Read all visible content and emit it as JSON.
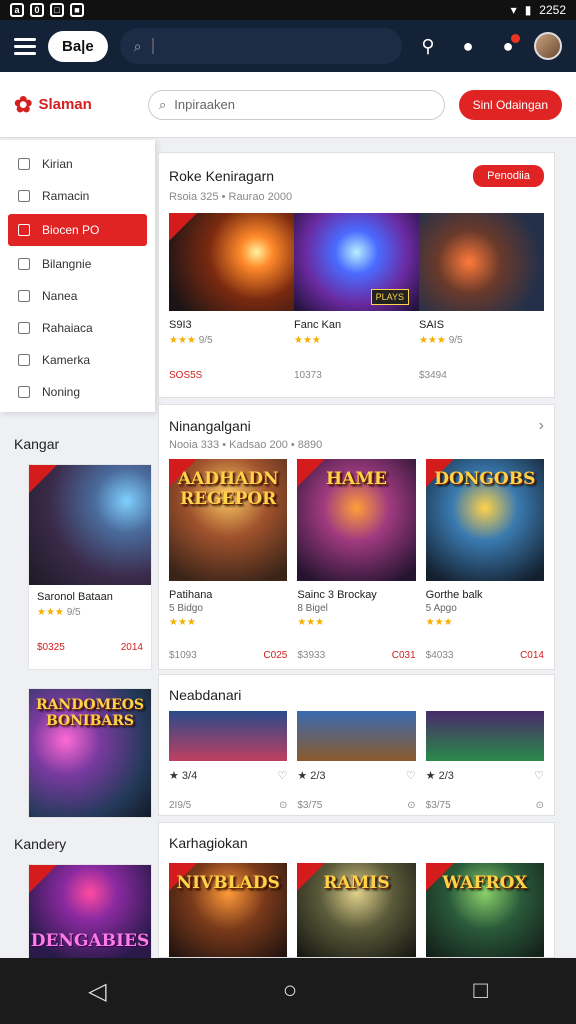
{
  "status": {
    "icons": [
      "a",
      "0",
      "□",
      "■"
    ],
    "time": "2252"
  },
  "appbar": {
    "brand": "Ba|e",
    "search_placeholder": ""
  },
  "header": {
    "logo_text": "Slaman",
    "search_placeholder": "Inpiraaken",
    "cta": "Sinl Odaingan"
  },
  "sidebar": {
    "items": [
      {
        "label": "Kirian",
        "icon": "users-icon"
      },
      {
        "label": "Ramacin",
        "icon": "list-icon"
      },
      {
        "label": "Biocen PO",
        "icon": "grid-icon",
        "active": true
      },
      {
        "label": "Bilangnie",
        "icon": "puzzle-icon"
      },
      {
        "label": "Nanea",
        "icon": "chat-icon"
      },
      {
        "label": "Rahaiaca",
        "icon": "image-icon"
      },
      {
        "label": "Kamerka",
        "icon": "tag-icon"
      },
      {
        "label": "Noning",
        "icon": "doc-icon"
      }
    ]
  },
  "left": {
    "section1": "Kangar",
    "section2": "Kandery",
    "card1": {
      "title": "Saronol Bataan",
      "stars": "★★★",
      "rating": "9/5",
      "price": "$0325",
      "tag": "2014"
    },
    "card2": {
      "title": "RANDOMEOS\nBONIBARS"
    },
    "card3": {
      "title": "DENGABIES"
    }
  },
  "panel1": {
    "title": "Roke Keniragarn",
    "subtitle": "Rsoia 325 • Raurao 2000",
    "button": "Penodiia",
    "items": [
      {
        "title": "S9I3",
        "stars": "★★★",
        "rating": "9/5",
        "price": "SOS5S",
        "count": "",
        "label": ""
      },
      {
        "title": "Fanc Kan",
        "stars": "★★★",
        "rating": "",
        "price": "",
        "count": "10373",
        "label": "PLAYS"
      },
      {
        "title": "SAIS",
        "stars": "★★★",
        "rating": "9/5",
        "price": "",
        "count": "$3494",
        "label": ""
      }
    ]
  },
  "panel2": {
    "title": "Ninangalgani",
    "subtitle": "Nooia 333 • Kadsao 200 • 8890",
    "items": [
      {
        "title": "Patihana",
        "sub": "5 Bidgo",
        "stars": "★★★",
        "price": "$1093",
        "tag": "C025",
        "art": "AADHADN\nREGEPOR"
      },
      {
        "title": "Sainc 3 Brockay",
        "sub": "8 Bigel",
        "stars": "★★★",
        "price": "$3933",
        "tag": "C031",
        "art": "HAME"
      },
      {
        "title": "Gorthe balk",
        "sub": "5 Apgo",
        "stars": "★★★",
        "price": "$4033",
        "tag": "C014",
        "art": "DONGOBS"
      }
    ]
  },
  "panel3": {
    "title": "Neabdanari",
    "items": [
      {
        "rating": "★ 3/4",
        "count": "2I9/5"
      },
      {
        "rating": "★ 2/3",
        "count": "$3/75"
      },
      {
        "rating": "★ 2/3",
        "count": "$3/75"
      }
    ]
  },
  "panel4": {
    "title": "Karhagiokan",
    "items": [
      {
        "art": "NIVBLADS"
      },
      {
        "art": "RAMIS"
      },
      {
        "art": "WAFROX"
      }
    ]
  },
  "navbar": {
    "back": "◁",
    "home": "○",
    "recents": "□"
  }
}
